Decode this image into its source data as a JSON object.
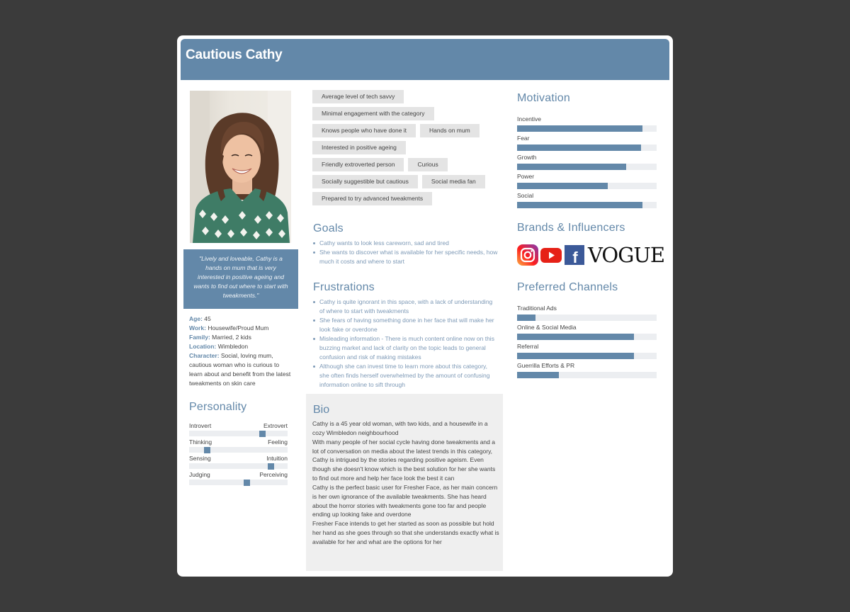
{
  "persona": {
    "name": "Cautious Cathy",
    "quote": "\"Lively and loveable, Cathy is a hands on mum that is very interested in positive ageing and wants to find out where to start with tweakments.\""
  },
  "facts": [
    {
      "label": "Age",
      "value": "45"
    },
    {
      "label": "Work",
      "value": "Housewife/Proud Mum"
    },
    {
      "label": "Family",
      "value": "Married, 2 kids"
    },
    {
      "label": "Location",
      "value": "Wimbledon"
    },
    {
      "label": "Character",
      "value": "Social, loving mum, cautious woman who is curious to learn about and benefit from the latest tweakments on skin care"
    }
  ],
  "personality": {
    "title": "Personality",
    "scales": [
      {
        "left": "Introvert",
        "right": "Extrovert",
        "value": 0.74
      },
      {
        "left": "Thinking",
        "right": "Feeling",
        "value": 0.18
      },
      {
        "left": "Sensing",
        "right": "Intuition",
        "value": 0.83
      },
      {
        "left": "Judging",
        "right": "Perceiving",
        "value": 0.58
      }
    ]
  },
  "tags": [
    [
      "Average level of tech savvy"
    ],
    [
      "Minimal engagement with the category"
    ],
    [
      "Knows people who have done it",
      "Hands on mum"
    ],
    [
      "Interested in positive ageing"
    ],
    [
      "Friendly extroverted person",
      "Curious"
    ],
    [
      "Socially suggestible but cautious",
      "Social media fan"
    ],
    [
      "Prepared to try advanced tweakments"
    ]
  ],
  "goals": {
    "title": "Goals",
    "items": [
      "Cathy wants to look less careworn, sad and tired",
      "She wants to discover what is available for her specific needs, how much it costs and where to start"
    ]
  },
  "frustrations": {
    "title": "Frustrations",
    "items": [
      "Cathy is quite ignorant in this space, with a lack of understanding of where to start with tweakments",
      "She fears of having something done in her face that will make her look fake or overdone",
      "Misleading information - There is much content online now on this buzzing market and lack of clarity on the topic leads to general confusion and risk of making mistakes",
      "Although she can invest time to learn more about this category, she often finds herself overwhelmed by the amount of confusing information online to sift through"
    ]
  },
  "bio": {
    "title": "Bio",
    "text": "Cathy is a 45 year old woman, with two kids, and a housewife in a cozy Wimbledon neighbourhood\nWith many people of her social cycle having done tweakments and a lot of conversation on media about the latest trends in this category, Cathy is intrigued by the stories regarding positive ageism. Even though she doesn't know which is the best solution for her she wants to find out more and help her face look the best it can\nCathy is the perfect basic user for Fresher Face, as her main concern is her own ignorance of the available tweakments. She has heard about the horror stories with tweakments gone too far and people ending up looking fake and overdone\nFresher Face intends to get her started as soon as possible but hold her hand as she goes through so that she understands exactly what is available for her and what are the options for her"
  },
  "motivation": {
    "title": "Motivation",
    "bars": [
      {
        "label": "Incentive",
        "value": 0.9
      },
      {
        "label": "Fear",
        "value": 0.89
      },
      {
        "label": "Growth",
        "value": 0.78
      },
      {
        "label": "Power",
        "value": 0.65
      },
      {
        "label": "Social",
        "value": 0.9
      }
    ]
  },
  "brands": {
    "title": "Brands & Influencers",
    "items": [
      {
        "name": "Instagram",
        "icon": "instagram-icon"
      },
      {
        "name": "YouTube",
        "icon": "youtube-icon"
      },
      {
        "name": "Facebook",
        "icon": "facebook-icon",
        "glyph": "f"
      },
      {
        "name": "Vogue",
        "icon": "vogue-logo",
        "glyph": "VOGUE"
      }
    ]
  },
  "channels": {
    "title": "Preferred Channels",
    "bars": [
      {
        "label": "Traditional Ads",
        "value": 0.13
      },
      {
        "label": "Online & Social Media",
        "value": 0.84
      },
      {
        "label": "Referral",
        "value": 0.84
      },
      {
        "label": "Guerrilla Efforts & PR",
        "value": 0.3
      }
    ]
  },
  "colors": {
    "accent": "#6388a9",
    "background": "#3b3b3b",
    "track": "#eceef1",
    "tag": "#e4e4e4"
  }
}
